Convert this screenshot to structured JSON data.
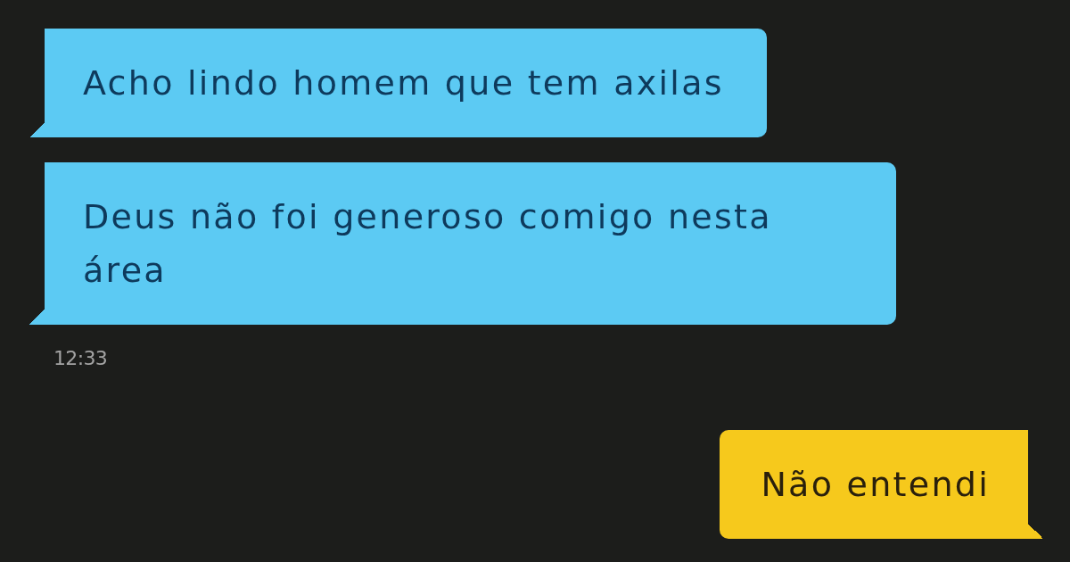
{
  "conversation": [
    {
      "kind": "received",
      "text": "Acho lindo homem que tem axilas"
    },
    {
      "kind": "received",
      "text": "Deus não foi generoso comigo nesta área"
    },
    {
      "kind": "time",
      "text": "12:33"
    },
    {
      "kind": "sent",
      "text": "Não entendi"
    }
  ]
}
